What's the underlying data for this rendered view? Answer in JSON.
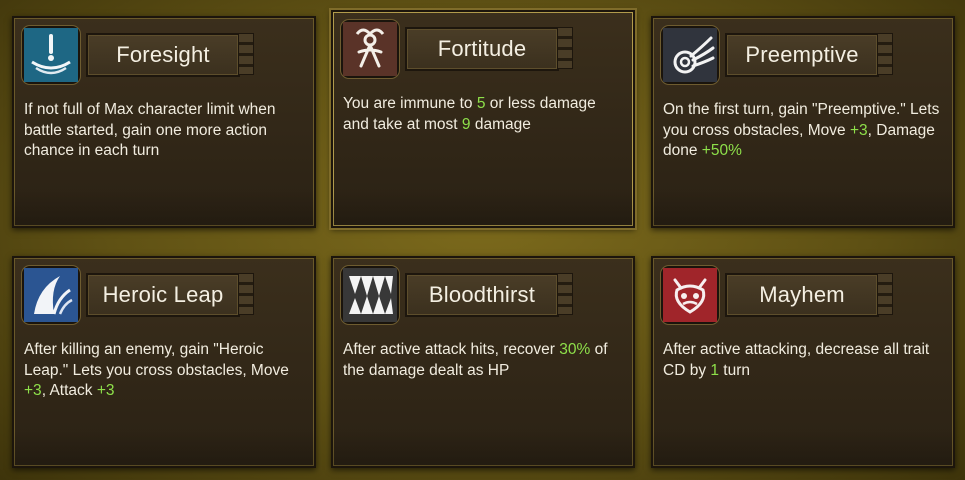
{
  "cards": [
    {
      "title": "Foresight",
      "icon": "foresight-icon",
      "desc": [
        {
          "t": "If not full of Max character limit when battle started, gain one more action chance in each turn"
        }
      ]
    },
    {
      "title": "Fortitude",
      "icon": "fortitude-icon",
      "desc": [
        {
          "t": "You are immune to "
        },
        {
          "t": "5",
          "hl": true
        },
        {
          "t": " or less damage and take at most "
        },
        {
          "t": "9",
          "hl": true
        },
        {
          "t": " damage"
        }
      ]
    },
    {
      "title": "Preemptive",
      "icon": "preemptive-icon",
      "desc": [
        {
          "t": "On the first turn, gain \"Preemptive.\" Lets you cross obstacles, Move "
        },
        {
          "t": "+3",
          "hl": true
        },
        {
          "t": ", Damage done "
        },
        {
          "t": "+50%",
          "hl": true
        }
      ]
    },
    {
      "title": "Heroic Leap",
      "icon": "heroic-leap-icon",
      "desc": [
        {
          "t": "After killing an enemy, gain \"Heroic Leap.\" Lets you cross obstacles, Move "
        },
        {
          "t": "+3",
          "hl": true
        },
        {
          "t": ", Attack "
        },
        {
          "t": "+3",
          "hl": true
        }
      ]
    },
    {
      "title": "Bloodthirst",
      "icon": "bloodthirst-icon",
      "desc": [
        {
          "t": "After active attack hits, recover "
        },
        {
          "t": "30%",
          "hl": true
        },
        {
          "t": " of the damage dealt as HP"
        }
      ]
    },
    {
      "title": "Mayhem",
      "icon": "mayhem-icon",
      "desc": [
        {
          "t": "After active attacking, decrease all trait CD by "
        },
        {
          "t": "1",
          "hl": true
        },
        {
          "t": " turn"
        }
      ]
    }
  ],
  "colors": {
    "highlight": "#8ee04a",
    "text": "#f1ecdf"
  }
}
